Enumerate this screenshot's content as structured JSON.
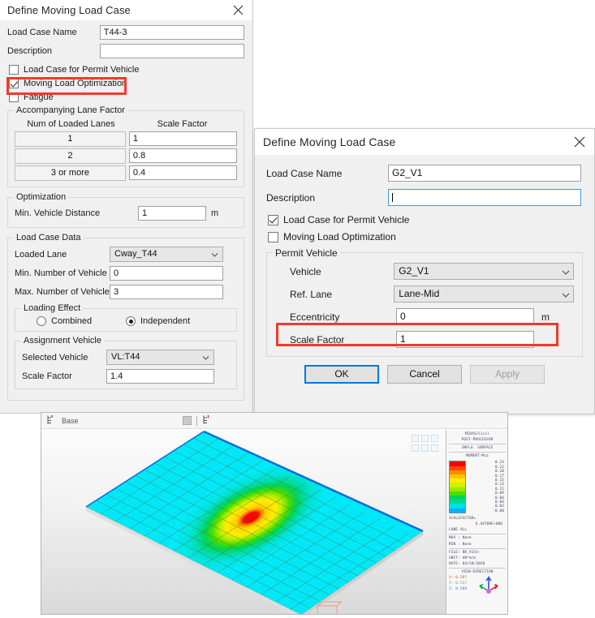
{
  "dialog1": {
    "title": "Define Moving Load Case",
    "close_icon": "close-icon",
    "fields": {
      "load_case_name_label": "Load Case Name",
      "load_case_name_value": "T44-3",
      "description_label": "Description",
      "description_value": ""
    },
    "checkboxes": [
      {
        "label": "Load Case for Permit Vehicle",
        "checked": false
      },
      {
        "label": "Moving Load Optimization",
        "checked": true
      },
      {
        "label": "Fatigue",
        "checked": false
      }
    ],
    "lane_factor": {
      "group_title": "Accompanying Lane Factor",
      "col1": "Num of Loaded Lanes",
      "col2": "Scale Factor",
      "rows": [
        {
          "lanes": "1",
          "factor": "1"
        },
        {
          "lanes": "2",
          "factor": "0.8"
        },
        {
          "lanes": "3 or more",
          "factor": "0.4"
        }
      ]
    },
    "optimization": {
      "group_title": "Optimization",
      "min_vehicle_distance_label": "Min. Vehicle Distance",
      "min_vehicle_distance_value": "1",
      "unit": "m"
    },
    "load_case_data": {
      "group_title": "Load Case Data",
      "loaded_lane_label": "Loaded Lane",
      "loaded_lane_value": "Cway_T44",
      "min_num_vehicle_label": "Min. Number of Vehicle",
      "min_num_vehicle_value": "0",
      "max_num_vehicle_label": "Max. Number of Vehicle",
      "max_num_vehicle_value": "3",
      "loading_effect": {
        "group_title": "Loading Effect",
        "options": [
          {
            "label": "Combined",
            "selected": false
          },
          {
            "label": "Independent",
            "selected": true
          }
        ]
      },
      "assignment_vehicle": {
        "group_title": "Assignment Vehicle",
        "selected_vehicle_label": "Selected Vehicle",
        "selected_vehicle_value": "VL:T44",
        "scale_factor_label": "Scale Factor",
        "scale_factor_value": "1.4"
      }
    }
  },
  "dialog2": {
    "title": "Define Moving Load Case",
    "close_icon": "close-icon",
    "fields": {
      "load_case_name_label": "Load Case Name",
      "load_case_name_value": "G2_V1",
      "description_label": "Description",
      "description_value": ""
    },
    "checkboxes": [
      {
        "label": "Load Case for Permit Vehicle",
        "checked": true
      },
      {
        "label": "Moving Load Optimization",
        "checked": false
      }
    ],
    "permit_vehicle": {
      "group_title": "Permit Vehicle",
      "vehicle_label": "Vehicle",
      "vehicle_value": "G2_V1",
      "ref_lane_label": "Ref. Lane",
      "ref_lane_value": "Lane-Mid",
      "eccentricity_label": "Eccentricity",
      "eccentricity_value": "0",
      "eccentricity_unit": "m",
      "scale_factor_label": "Scale Factor",
      "scale_factor_value": "1"
    },
    "buttons": {
      "ok": "OK",
      "cancel": "Cancel",
      "apply": "Apply"
    }
  },
  "annotations": {
    "highlight_color": "#ef3b2d"
  },
  "viewport": {
    "toolbar": {
      "base_label": "Base",
      "base_icon": "works-tree-icon",
      "dropdown_icon": "dropdown-icon",
      "second_icon": "works-tree-icon"
    },
    "legend": {
      "line1": "MIDAS/Civil",
      "line2": "POST-PROCESSOR",
      "line3": "INFLU. SURFACE",
      "line4": "MOMENT-Mzz",
      "values": [
        "0.24",
        "0.22",
        "0.20",
        "0.17",
        "0.15",
        "0.13",
        "0.11",
        "0.09",
        "0.06",
        "0.04",
        "0.02",
        "-0.00"
      ],
      "colors": [
        "#ff0000",
        "#ff4a00",
        "#ff8a00",
        "#ffc400",
        "#ffee00",
        "#d2f000",
        "#9ae800",
        "#4ade00",
        "#00d45a",
        "#00d8a0",
        "#00e0e0",
        "#00b0ff"
      ],
      "scalefactor_label": "SCALEFACTOR=",
      "scalefactor_value": "6.44708E+000",
      "lane_label": "LANE ALL",
      "max_label": "MAX : None",
      "min_label": "MIN : None",
      "file_label": "FILE: BR_9154-",
      "unit_label": "UNIT: kN*m/m",
      "date_label": "DATE: 04/18/2020",
      "view_direction_label": "VIEW-DIRECTION",
      "view_x": "X:-0.587",
      "view_y": "Y:-0.557",
      "view_z": "Z: 0.588"
    }
  }
}
